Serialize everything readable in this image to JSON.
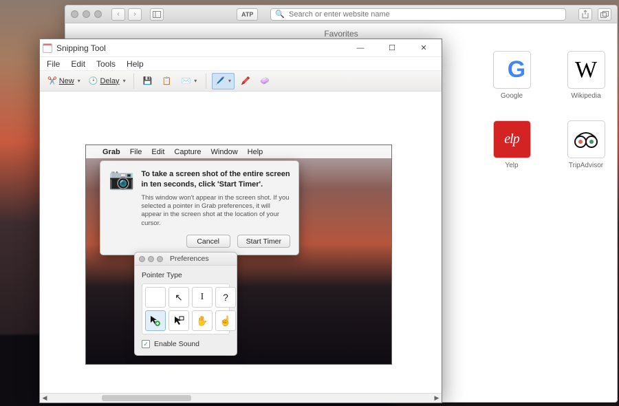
{
  "safari": {
    "search_placeholder": "Search or enter website name",
    "favorites_label": "Favorites",
    "favorites": [
      {
        "name": "Google"
      },
      {
        "name": "Wikipedia"
      },
      {
        "name": "Yelp"
      },
      {
        "name": "TripAdvisor"
      }
    ]
  },
  "snipping_tool": {
    "title": "Snipping Tool",
    "menu": {
      "file": "File",
      "edit": "Edit",
      "tools": "Tools",
      "help": "Help"
    },
    "toolbar": {
      "new_label": "New",
      "delay_label": "Delay"
    }
  },
  "grab": {
    "menubar": {
      "grab": "Grab",
      "file": "File",
      "edit": "Edit",
      "capture": "Capture",
      "window": "Window",
      "help": "Help"
    },
    "dialog": {
      "headline": "To take a screen shot of the entire screen in ten seconds, click 'Start Timer'.",
      "body": "This window won't appear in the screen shot. If you selected a pointer in Grab preferences, it will appear in the screen shot at the location of your cursor.",
      "cancel": "Cancel",
      "start": "Start Timer"
    },
    "prefs": {
      "title": "Preferences",
      "pointer_type": "Pointer Type",
      "enable_sound": "Enable Sound",
      "enable_sound_checked": true
    }
  }
}
